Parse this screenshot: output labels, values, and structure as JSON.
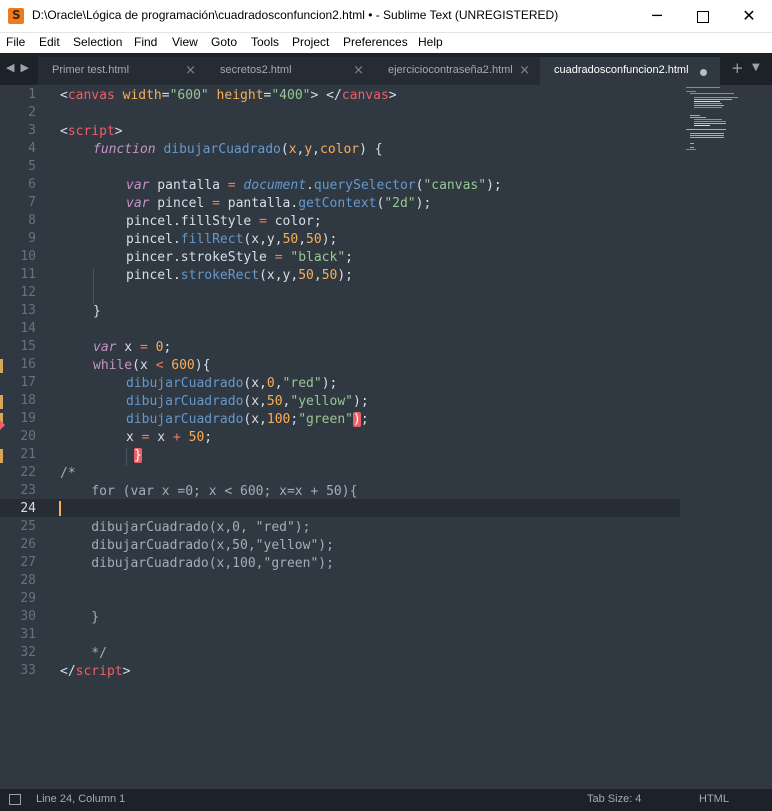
{
  "window": {
    "title": "D:\\Oracle\\Lógica de programación\\cuadradosconfuncion2.html • - Sublime Text (UNREGISTERED)",
    "minimize": "─",
    "close": "✕"
  },
  "menu": [
    {
      "label": "File"
    },
    {
      "label": "Edit"
    },
    {
      "label": "Selection"
    },
    {
      "label": "Find"
    },
    {
      "label": "View"
    },
    {
      "label": "Goto"
    },
    {
      "label": "Tools"
    },
    {
      "label": "Project"
    },
    {
      "label": "Preferences"
    },
    {
      "label": "Help"
    }
  ],
  "tabs": {
    "nav": "◀▶",
    "items": [
      {
        "label": "Primer test.html",
        "close": "×"
      },
      {
        "label": "secretos2.html",
        "close": "×"
      },
      {
        "label": "ejerciciocontraseña2.html",
        "close": "×"
      },
      {
        "label": "cuadradosconfuncion2.html",
        "active": true
      }
    ],
    "new_tab": "+",
    "more": "▼"
  },
  "editor": {
    "line_numbers": [
      "1",
      "2",
      "3",
      "4",
      "5",
      "6",
      "7",
      "8",
      "9",
      "10",
      "11",
      "12",
      "13",
      "14",
      "15",
      "16",
      "17",
      "18",
      "19",
      "20",
      "21",
      "22",
      "23",
      "24",
      "25",
      "26",
      "27",
      "28",
      "29",
      "30",
      "31",
      "32",
      "33"
    ],
    "current_line": 24,
    "modified_lines": [
      16,
      18,
      19,
      21
    ],
    "error_line": 19,
    "code": {
      "l1": {
        "a": "<",
        "b": "canvas",
        "c": " width",
        "d": "=",
        "e": "\"600\"",
        "f": " height",
        "g": "=",
        "h": "\"400\"",
        "i": ">",
        "j": " </",
        "k": "canvas",
        "l": ">"
      },
      "l3": {
        "a": "<",
        "b": "script",
        "c": ">"
      },
      "l4": {
        "a": "function",
        "b": " dibujarCuadrado",
        "c": "(",
        "d": "x",
        "e": ",",
        "f": "y",
        "g": ",",
        "h": "color",
        "i": ") {"
      },
      "l6": {
        "a": "var",
        "b": " pantalla ",
        "c": "=",
        "d": " document",
        "e": ".",
        "f": "querySelector",
        "g": "(",
        "h": "\"canvas\"",
        "i": ");"
      },
      "l7": {
        "a": "var",
        "b": " pincel ",
        "c": "=",
        "d": " pantalla.",
        "e": "getContext",
        "f": "(",
        "g": "\"2d\"",
        "h": ");"
      },
      "l8": {
        "a": "pincel.fillStyle ",
        "b": "=",
        "c": " color;"
      },
      "l9": {
        "a": "pincel.",
        "b": "fillRect",
        "c": "(x,y,",
        "d": "50",
        "e": ",",
        "f": "50",
        "g": ");"
      },
      "l10": {
        "a": "pincer.strokeStyle ",
        "b": "=",
        "c": " ",
        "d": "\"black\"",
        "e": ";"
      },
      "l11": {
        "a": "pincel.",
        "b": "strokeRect",
        "c": "(x,y,",
        "d": "50",
        "e": ",",
        "f": "50",
        "g": ");"
      },
      "l13": {
        "a": "}"
      },
      "l15": {
        "a": "var",
        "b": " x ",
        "c": "=",
        "d": " ",
        "e": "0",
        "f": ";"
      },
      "l16": {
        "a": "while",
        "b": "(x ",
        "c": "<",
        "d": " ",
        "e": "600",
        "f": "){"
      },
      "l17": {
        "a": "dibujarCuadrado",
        "b": "(x,",
        "c": "0",
        "d": ",",
        "e": "\"red\"",
        "f": ");"
      },
      "l18": {
        "a": "dibujarCuadrado",
        "b": "(x,",
        "c": "50",
        "d": ",",
        "e": "\"yellow\"",
        "f": ");"
      },
      "l19": {
        "a": "dibujarCuadrado",
        "b": "(x,",
        "c": "100",
        "d": ";",
        "e": "\"green\"",
        "f": ")",
        "g": ";"
      },
      "l20": {
        "a": "x ",
        "b": "=",
        "c": " x ",
        "d": "+",
        "e": " ",
        "f": "50",
        "g": ";"
      },
      "l21": {
        "a": "}"
      },
      "l22": {
        "a": "/*"
      },
      "l23": {
        "a": "    for (var x =0; x < 600; x=x + 50){"
      },
      "l25": {
        "a": "    dibujarCuadrado(x,0, \"red\");"
      },
      "l26": {
        "a": "    dibujarCuadrado(x,50,\"yellow\");"
      },
      "l27": {
        "a": "    dibujarCuadrado(x,100,\"green\");"
      },
      "l30": {
        "a": "    }"
      },
      "l32": {
        "a": "    */"
      },
      "l33": {
        "a": "</",
        "b": "script",
        "c": ">"
      }
    }
  },
  "status": {
    "position": "Line 24, Column 1",
    "tab_size": "Tab Size: 4",
    "syntax": "HTML"
  },
  "colors": {
    "background": "#303841",
    "tag": "#ec5f67",
    "string": "#99c794",
    "keyword": "#c594c5",
    "function": "#6699cc",
    "number": "#f9ae58"
  }
}
